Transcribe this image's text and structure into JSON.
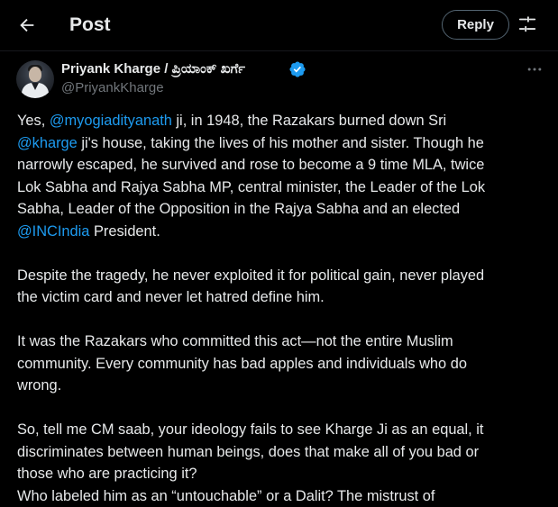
{
  "header": {
    "back_icon": "arrow-left-icon",
    "title": "Post",
    "reply_label": "Reply",
    "filter_icon": "sliders-icon"
  },
  "author": {
    "name": "Priyank Kharge / ಪ್ರಿಯಾಂಕ್ ಖರ್ಗೆ",
    "handle": "@PriyankKharge",
    "verified": true,
    "verified_icon": "verified-badge-icon",
    "more_icon": "more-horizontal-icon"
  },
  "colors": {
    "background": "#000000",
    "text": "#e7e9ea",
    "secondary_text": "#71767b",
    "link": "#1d9bf0",
    "border": "#536471"
  },
  "post": {
    "p1": {
      "l1_a": "Yes, ",
      "l1_m": "@myogiadityanath",
      "l1_b": " ji, in 1948, the Razakars burned down Sri",
      "l2_m": "@kharge",
      "l2_b": " ji's house, taking the lives of his mother and sister. Though he",
      "l3": "narrowly escaped, he survived and rose to become a 9 time MLA, twice",
      "l4": "Lok Sabha and Rajya Sabha MP, central minister, the Leader of the Lok",
      "l5": "Sabha, Leader of the Opposition in the Rajya Sabha and an elected",
      "l6_m": "@INCIndia",
      "l6_b": " President."
    },
    "p2": {
      "l1": "Despite the tragedy, he never exploited it for political gain, never played",
      "l2": "the victim card and never let hatred define him."
    },
    "p3": {
      "l1": "It was the Razakars who committed this act—not the entire Muslim",
      "l2": "community. Every community has bad apples and individuals who do",
      "l3": "wrong."
    },
    "p4": {
      "l1": "So, tell me CM saab,  your ideology fails to see Kharge Ji as an equal, it",
      "l2": "discriminates between human beings, does that make all of you bad or",
      "l3": "those who are practicing it?",
      "l4_partial": "Who labeled him as an “untouchable” or a Dalit? The mistrust of"
    }
  }
}
